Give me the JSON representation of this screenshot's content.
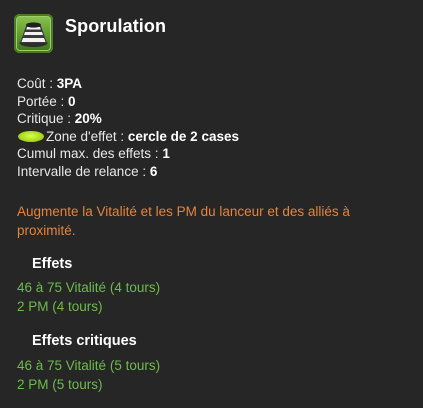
{
  "spell": {
    "icon": "sporulation-spell-icon",
    "title": "Sporulation"
  },
  "stats": {
    "cost_label": "Coût : ",
    "cost_value": "3PA",
    "range_label": "Portée : ",
    "range_value": "0",
    "critical_label": "Critique : ",
    "critical_value": "20%",
    "zone_icon": "zone-circle-icon",
    "zone_label": "Zone d'effet : ",
    "zone_value": "cercle de 2 cases",
    "max_stack_label": "Cumul max. des effets : ",
    "max_stack_value": "1",
    "recast_label": "Intervalle de relance : ",
    "recast_value": "6"
  },
  "description": "Augmente la Vitalité et les PM du lanceur et des alliés à proximité.",
  "effects": {
    "heading": "Effets",
    "items": [
      "46 à 75 Vitalité (4 tours)",
      "2 PM (4 tours)"
    ]
  },
  "critical_effects": {
    "heading": "Effets critiques",
    "items": [
      "46 à 75 Vitalité (5 tours)",
      "2 PM (5 tours)"
    ]
  },
  "colors": {
    "background": "#262626",
    "description": "#e8833a",
    "effect": "#6dbb4b",
    "zone_icon": "#b5e02a"
  }
}
